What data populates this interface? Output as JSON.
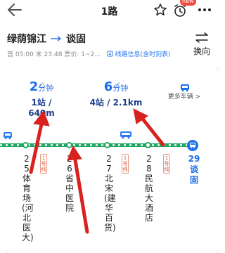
{
  "header": {
    "title": "1路",
    "alarm_badge": "new"
  },
  "route": {
    "from": "绿荫锦江",
    "to": "谈固",
    "info": "首 05:00 末 23:48 票价: 1~2...",
    "info_link": "线路信息(含时刻表)",
    "swap_label": "换向"
  },
  "arrivals": [
    {
      "mins": "2",
      "unit": "分钟",
      "dist": "1站 / 640m"
    },
    {
      "mins": "6",
      "unit": "分钟",
      "dist": "4站 / 2.1km"
    }
  ],
  "more_cars": "更多车辆 >",
  "stops": [
    {
      "name": "25体育场(河北医大)",
      "tag": "1号线"
    },
    {
      "name": "26省中医院",
      "tag": ""
    },
    {
      "name": "27北宋(建华百货)",
      "tag": "1号线"
    },
    {
      "name": "28民航大酒店",
      "tag": "1号线"
    }
  ],
  "final_stop": {
    "name": "29谈固"
  },
  "colors": {
    "accent": "#1e6fe8",
    "line": "#1fa764",
    "annotation": "#d9211f"
  }
}
